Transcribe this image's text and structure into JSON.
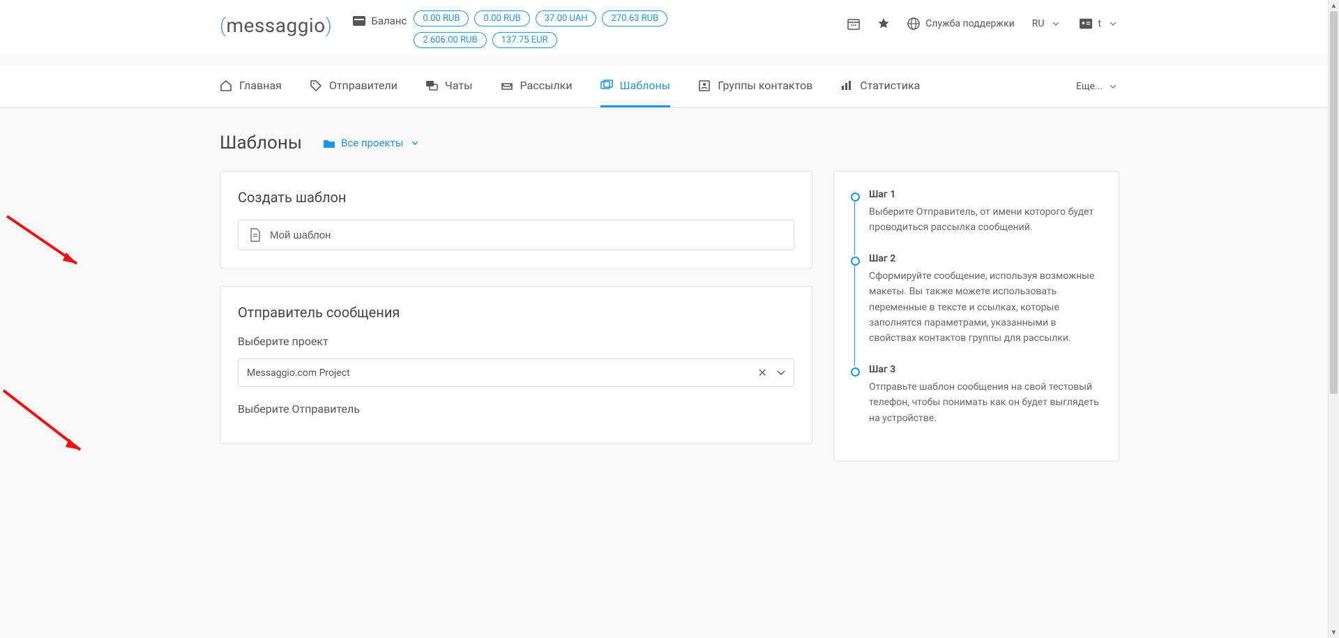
{
  "brand": "messaggio",
  "balance_label": "Баланс",
  "balances": [
    "0.00 RUB",
    "0.00 RUB",
    "37.00 UAH",
    "270.63 RUB",
    "2 606.00 RUB",
    "137.75 EUR"
  ],
  "support_label": "Служба поддержки",
  "language": "RU",
  "user_short": "t",
  "nav": {
    "home": "Главная",
    "senders": "Отправители",
    "chats": "Чаты",
    "campaigns": "Рассылки",
    "templates": "Шаблоны",
    "contact_groups": "Группы контактов",
    "statistics": "Статистика",
    "more": "Еще..."
  },
  "page_title": "Шаблоны",
  "projects_filter": "Все проекты",
  "create_template_heading": "Создать шаблон",
  "template_name_value": "Мой шаблон",
  "sender_section_heading": "Отправитель сообщения",
  "select_project_label": "Выберите проект",
  "selected_project": "Messaggio.com Project",
  "select_sender_label": "Выберите Отправитель",
  "steps": [
    {
      "title": "Шаг 1",
      "text": "Выберите Отправитель, от имени которого будет проводиться рассылка сообщений."
    },
    {
      "title": "Шаг 2",
      "text": "Сформируйте сообщение, используя возможные макеты. Вы также можете использовать переменные в тексте и ссылках, которые заполнятся параметрами, указанными в свойствах контактов группы для рассылки."
    },
    {
      "title": "Шаг 3",
      "text": "Отправьте шаблон сообщения на свой тестовый телефон, чтобы понимать как он будет выглядеть на устройстве."
    }
  ]
}
